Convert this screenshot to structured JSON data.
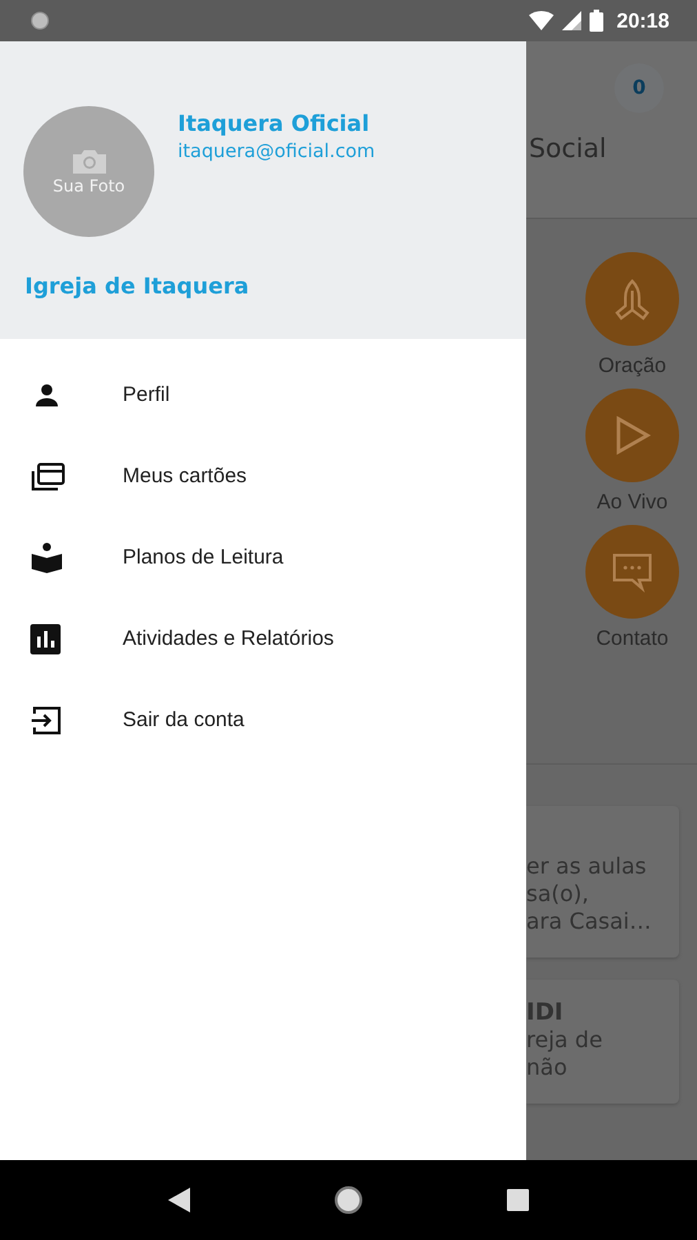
{
  "status_bar": {
    "time": "20:18"
  },
  "drawer": {
    "photo_label": "Sua Foto",
    "name": "Itaquera Oficial",
    "email": "itaquera@oficial.com",
    "church": "Igreja de Itaquera",
    "menu": [
      {
        "kind": "person",
        "label": "Perfil"
      },
      {
        "kind": "cards",
        "label": "Meus cartões"
      },
      {
        "kind": "book",
        "label": "Planos de Leitura"
      },
      {
        "kind": "chart",
        "label": "Atividades e Relatórios"
      },
      {
        "kind": "exit",
        "label": "Sair da conta"
      }
    ]
  },
  "background": {
    "badge": "0",
    "title": "Social",
    "actions": [
      {
        "kind": "pray",
        "label": "Oração"
      },
      {
        "kind": "play",
        "label": "Ao Vivo"
      },
      {
        "kind": "chat",
        "label": "Contato"
      }
    ],
    "cards": [
      {
        "lines": [
          "er as aulas",
          "sa(o),",
          "ara Casai…"
        ]
      },
      {
        "lines": [
          "IDI",
          "reja de",
          "não"
        ]
      }
    ]
  }
}
